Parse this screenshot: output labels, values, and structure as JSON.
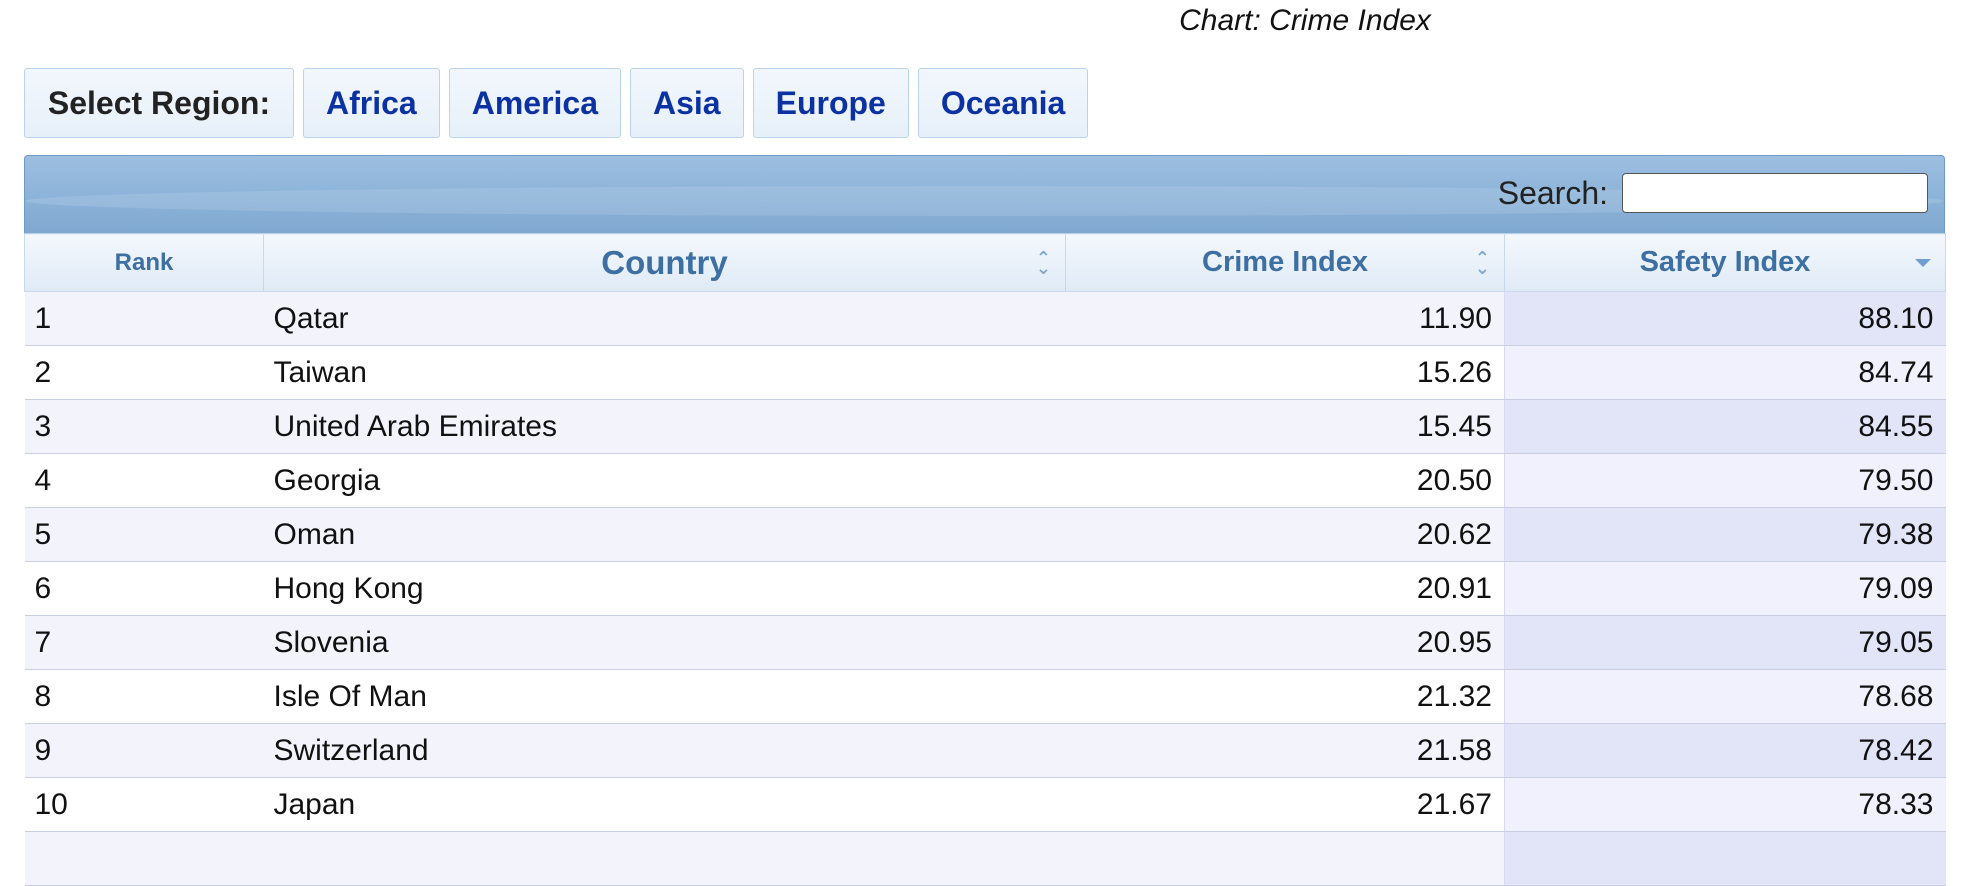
{
  "caption": "Chart: Crime Index",
  "region_selector": {
    "label": "Select Region:",
    "regions": [
      "Africa",
      "America",
      "Asia",
      "Europe",
      "Oceania"
    ]
  },
  "search": {
    "label": "Search:",
    "value": ""
  },
  "table": {
    "columns": [
      "Rank",
      "Country",
      "Crime Index",
      "Safety Index"
    ],
    "sorted_column": "Safety Index",
    "sort_direction": "descending",
    "rows": [
      {
        "rank": "1",
        "country": "Qatar",
        "crime": "11.90",
        "safety": "88.10"
      },
      {
        "rank": "2",
        "country": "Taiwan",
        "crime": "15.26",
        "safety": "84.74"
      },
      {
        "rank": "3",
        "country": "United Arab Emirates",
        "crime": "15.45",
        "safety": "84.55"
      },
      {
        "rank": "4",
        "country": "Georgia",
        "crime": "20.50",
        "safety": "79.50"
      },
      {
        "rank": "5",
        "country": "Oman",
        "crime": "20.62",
        "safety": "79.38"
      },
      {
        "rank": "6",
        "country": "Hong Kong",
        "crime": "20.91",
        "safety": "79.09"
      },
      {
        "rank": "7",
        "country": "Slovenia",
        "crime": "20.95",
        "safety": "79.05"
      },
      {
        "rank": "8",
        "country": "Isle Of Man",
        "crime": "21.32",
        "safety": "78.68"
      },
      {
        "rank": "9",
        "country": "Switzerland",
        "crime": "21.58",
        "safety": "78.42"
      },
      {
        "rank": "10",
        "country": "Japan",
        "crime": "21.67",
        "safety": "78.33"
      },
      {
        "rank": "",
        "country": "",
        "crime": "",
        "safety": ""
      }
    ]
  },
  "colors": {
    "link": "#0c31a3",
    "header_text": "#3d6fa3",
    "toolbar": "#8fb5da"
  }
}
